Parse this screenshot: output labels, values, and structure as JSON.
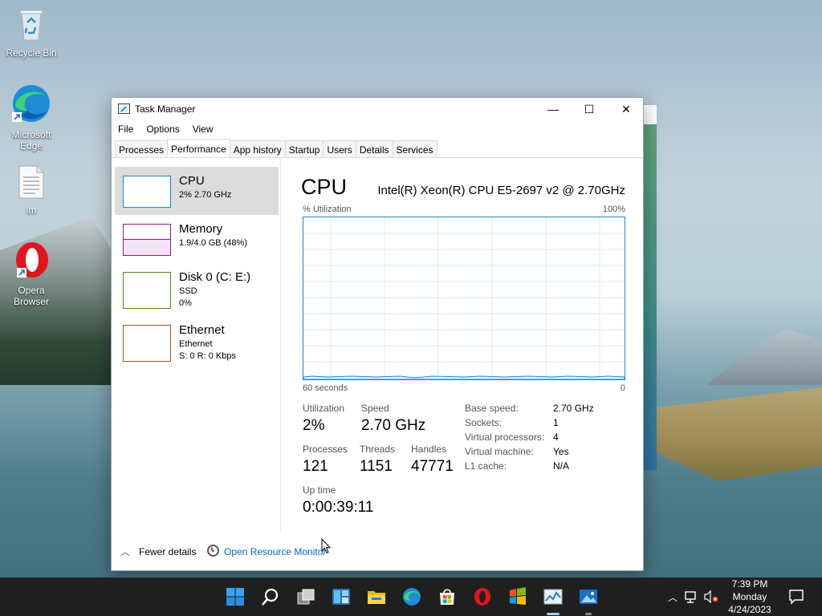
{
  "desktop": {
    "icons": [
      {
        "label": "Recycle Bin",
        "icon": "recycle-bin-icon"
      },
      {
        "label": "Microsoft Edge",
        "icon": "edge-icon"
      },
      {
        "label": "lm",
        "icon": "text-file-icon"
      },
      {
        "label": "Opera Browser",
        "icon": "opera-icon"
      }
    ]
  },
  "window": {
    "title": "Task Manager",
    "controls": {
      "minimize": "—",
      "maximize": "☐",
      "close": "✕"
    },
    "menu": [
      "File",
      "Options",
      "View"
    ],
    "tabs": [
      "Processes",
      "Performance",
      "App history",
      "Startup",
      "Users",
      "Details",
      "Services"
    ],
    "active_tab": "Performance"
  },
  "sidebar": {
    "items": [
      {
        "name": "CPU",
        "line1": "2%  2.70 GHz",
        "line2": "",
        "color": "#1a87c9"
      },
      {
        "name": "Memory",
        "line1": "1.9/4.0 GB (48%)",
        "line2": "",
        "color": "#8b1f8e"
      },
      {
        "name": "Disk 0 (C: E:)",
        "line1": "SSD",
        "line2": "0%",
        "color": "#4d8a12"
      },
      {
        "name": "Ethernet",
        "line1": "Ethernet",
        "line2": "S: 0  R: 0 Kbps",
        "color": "#a5541a"
      }
    ]
  },
  "cpu": {
    "title": "CPU",
    "model": "Intel(R) Xeon(R) CPU E5-2697 v2 @ 2.70GHz",
    "graph_label": "% Utilization",
    "graph_max": "100%",
    "axis_left": "60 seconds",
    "axis_right": "0",
    "stats": {
      "utilization_label": "Utilization",
      "utilization": "2%",
      "speed_label": "Speed",
      "speed": "2.70 GHz",
      "processes_label": "Processes",
      "processes": "121",
      "threads_label": "Threads",
      "threads": "1151",
      "handles_label": "Handles",
      "handles": "47771",
      "uptime_label": "Up time",
      "uptime": "0:00:39:11"
    },
    "details": [
      {
        "label": "Base speed:",
        "value": "2.70 GHz"
      },
      {
        "label": "Sockets:",
        "value": "1"
      },
      {
        "label": "Virtual processors:",
        "value": "4"
      },
      {
        "label": "Virtual machine:",
        "value": "Yes"
      },
      {
        "label": "L1 cache:",
        "value": "N/A"
      }
    ]
  },
  "footer": {
    "fewer_details": "Fewer details",
    "resource_monitor": "Open Resource Monitor"
  },
  "taskbar": {
    "apps": [
      "start-icon",
      "search-icon",
      "task-view-icon",
      "widgets-icon",
      "file-explorer-icon",
      "edge-icon",
      "store-icon",
      "opera-icon",
      "winrar-icon",
      "task-manager-icon",
      "photos-icon"
    ],
    "clock_time": "7:39 PM",
    "clock_day": "Monday",
    "clock_date": "4/24/2023"
  }
}
